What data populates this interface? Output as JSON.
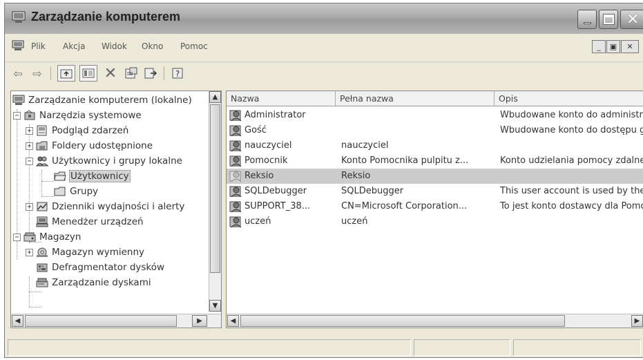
{
  "window": {
    "title": "Zarządzanie komputerem"
  },
  "menubar": {
    "items": [
      "Plik",
      "Akcja",
      "Widok",
      "Okno",
      "Pomoc"
    ]
  },
  "toolbar": {
    "buttons": [
      "back-icon",
      "forward-icon",
      "up-folder-icon",
      "show-hide-tree-icon",
      "delete-icon",
      "properties-icon",
      "export-icon",
      "help-icon"
    ]
  },
  "tree": {
    "items": [
      {
        "label": "Zarządzanie komputerem (lokalne)"
      },
      {
        "label": "Narzędzia systemowe"
      },
      {
        "label": "Podgląd zdarzeń"
      },
      {
        "label": "Foldery udostępnione"
      },
      {
        "label": "Użytkownicy i grupy lokalne"
      },
      {
        "label": "Użytkownicy"
      },
      {
        "label": "Grupy"
      },
      {
        "label": "Dzienniki wydajności i alerty"
      },
      {
        "label": "Menedżer urządzeń"
      },
      {
        "label": "Magazyn"
      },
      {
        "label": "Magazyn wymienny"
      },
      {
        "label": "Defragmentator dysków"
      },
      {
        "label": "Zarządzanie dyskami"
      }
    ]
  },
  "list": {
    "columns": [
      "Nazwa",
      "Pełna nazwa",
      "Opis"
    ],
    "rows": [
      {
        "name": "Administrator",
        "full": "",
        "desc": "Wbudowane konto do administrowania komputerem/domeną"
      },
      {
        "name": "Gość",
        "full": "",
        "desc": "Wbudowane konto do dostępu gościa do komputera/domeny"
      },
      {
        "name": "nauczyciel",
        "full": "nauczyciel",
        "desc": ""
      },
      {
        "name": "Pomocnik",
        "full": "Konto Pomocnika pulpitu z...",
        "desc": "Konto udzielania pomocy zdalnej"
      },
      {
        "name": "Reksio",
        "full": "Reksio",
        "desc": ""
      },
      {
        "name": "SQLDebugger",
        "full": "SQLDebugger",
        "desc": "This user account is used by the Visual Studio"
      },
      {
        "name": "SUPPORT_38...",
        "full": "CN=Microsoft Corporation...",
        "desc": "To jest konto dostawcy dla Pomocy i obsługi technicznej"
      },
      {
        "name": "uczeń",
        "full": "uczeń",
        "desc": ""
      }
    ]
  },
  "colors": {
    "selection": "#cccccc",
    "window_bg": "#ece9d8",
    "title_gradient_top": "#c9c9c9"
  }
}
